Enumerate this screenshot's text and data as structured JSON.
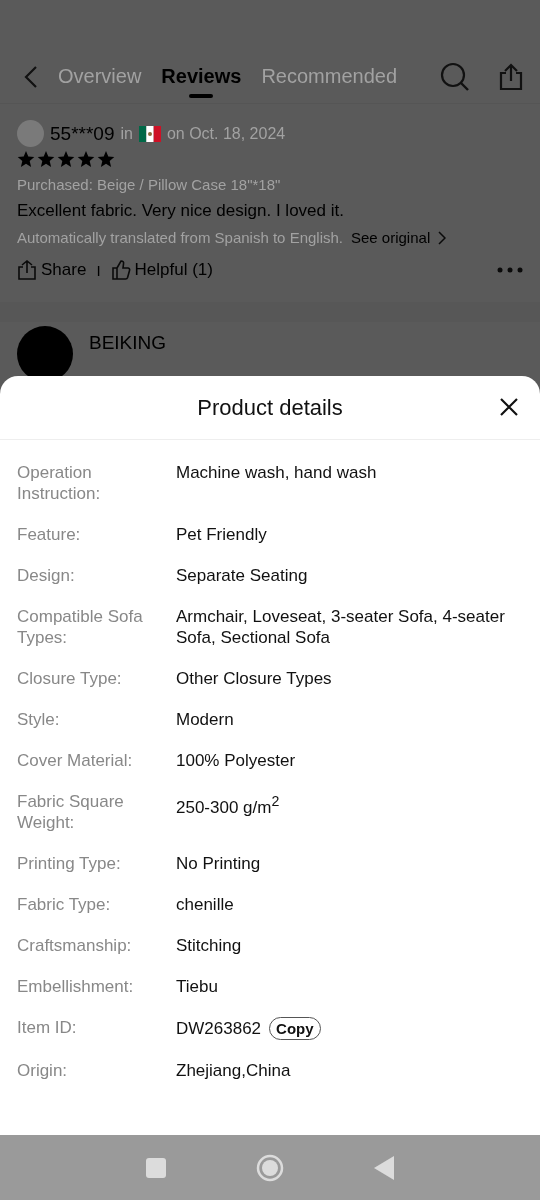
{
  "top_nav": {
    "tabs": [
      {
        "label": "Overview",
        "selected": false
      },
      {
        "label": "Reviews",
        "selected": true
      },
      {
        "label": "Recommended",
        "selected": false
      }
    ]
  },
  "review": {
    "user": "55***09",
    "in_text": "in",
    "date": "on Oct. 18, 2024",
    "stars": 5,
    "purchased": "Purchased: Beige / Pillow Case 18\"*18\"",
    "text": "Excellent fabric. Very nice design. I loved it.",
    "translation_note": "Automatically translated from Spanish to English.",
    "see_original": "See original",
    "share": "Share",
    "separator": "I",
    "helpful": "Helpful (1)"
  },
  "next_review": {
    "name": "BEIKING"
  },
  "sheet": {
    "title": "Product details",
    "rows": [
      {
        "label": "Operation Instruction:",
        "value": "Machine wash, hand wash"
      },
      {
        "label": "Feature:",
        "value": "Pet Friendly"
      },
      {
        "label": "Design:",
        "value": "Separate Seating"
      },
      {
        "label": "Compatible Sofa Types:",
        "value": "Armchair, Loveseat, 3-seater Sofa, 4-seater Sofa, Sectional Sofa"
      },
      {
        "label": "Closure Type:",
        "value": "Other Closure Types"
      },
      {
        "label": "Style:",
        "value": "Modern"
      },
      {
        "label": "Cover Material:",
        "value": "100% Polyester"
      },
      {
        "label": "Fabric Square Weight:",
        "value": "250-300 g/m$^{2}$"
      },
      {
        "label": "Printing Type:",
        "value": "No Printing"
      },
      {
        "label": "Fabric Type:",
        "value": "chenille"
      },
      {
        "label": "Craftsmanship:",
        "value": "Stitching"
      },
      {
        "label": "Embellishment:",
        "value": "Tiebu"
      },
      {
        "label": "Item ID:",
        "value": "DW263862",
        "action": "Copy"
      },
      {
        "label": "Origin:",
        "value": "Zhejiang,China"
      }
    ]
  }
}
